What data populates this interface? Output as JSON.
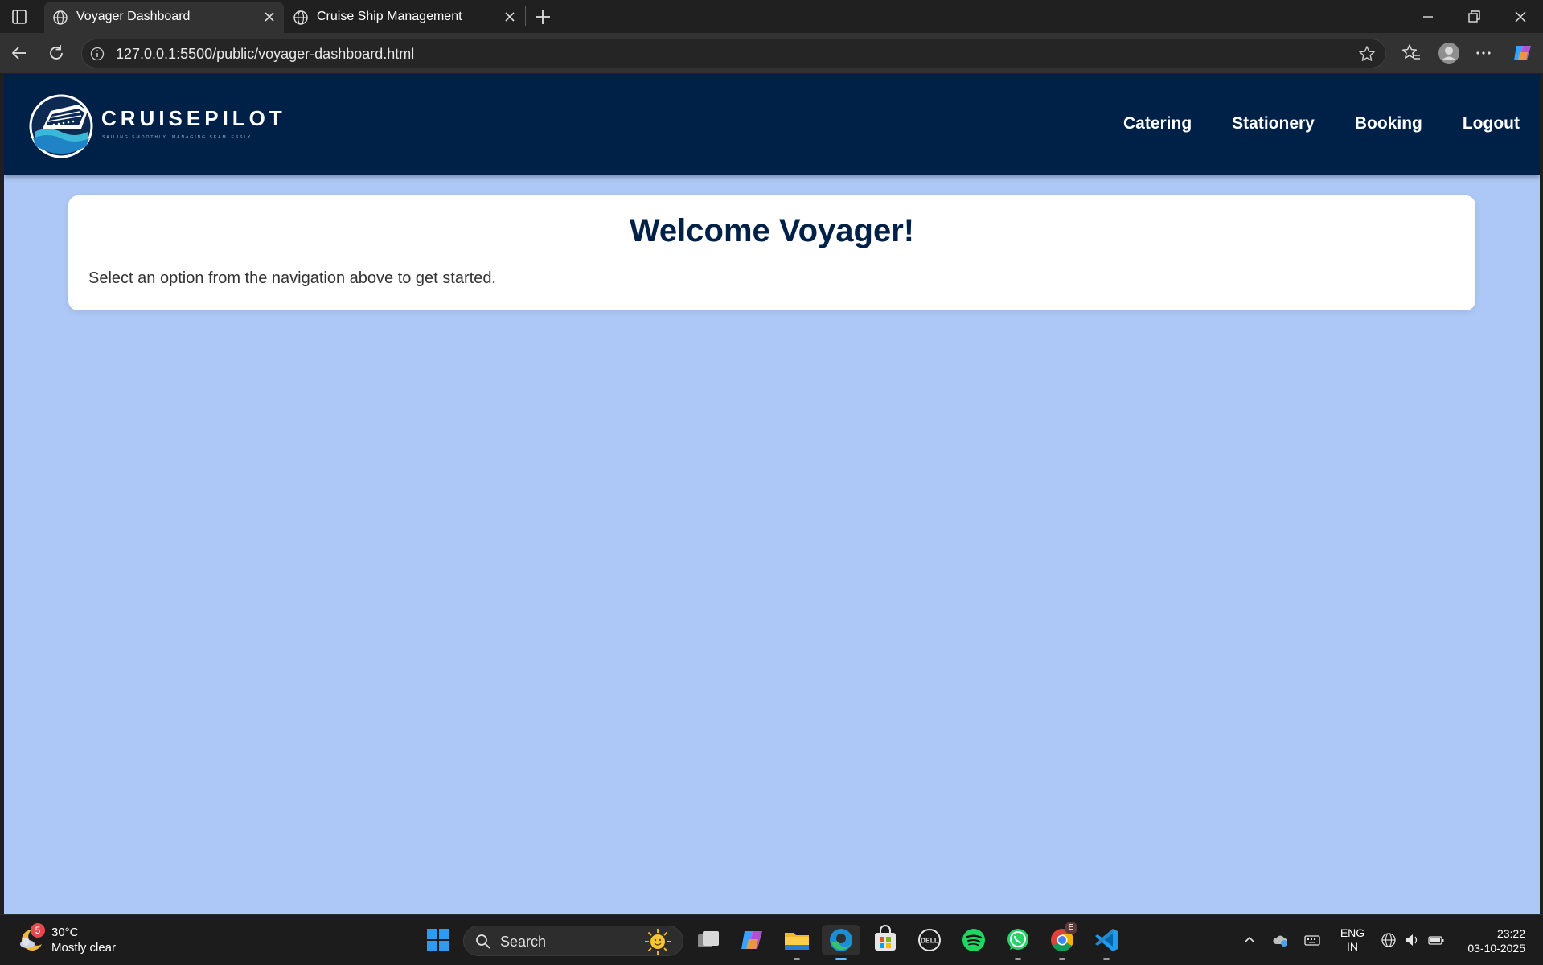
{
  "browser": {
    "tabs": [
      {
        "title": "Voyager Dashboard",
        "active": true
      },
      {
        "title": "Cruise Ship Management",
        "active": false
      }
    ],
    "address_url": "127.0.0.1:5500/public/voyager-dashboard.html"
  },
  "site": {
    "brand": "CRUISEPILOT",
    "tagline": "SAILING SMOOTHLY. MANAGING SEAMLESSLY",
    "nav": [
      "Catering",
      "Stationery",
      "Booking",
      "Logout"
    ],
    "colors": {
      "header_bg": "#002147",
      "page_bg": "#adc8f6",
      "card_bg": "#ffffff",
      "title_color": "#002147"
    }
  },
  "welcome": {
    "title": "Welcome Voyager!",
    "message": "Select an option from the navigation above to get started."
  },
  "taskbar": {
    "weather_temp": "30°C",
    "weather_desc": "Mostly clear",
    "weather_badge": "5",
    "search_label": "Search",
    "language_line1": "ENG",
    "language_line2": "IN",
    "time": "23:22",
    "date": "03-10-2025",
    "chrome_badge": "E",
    "apps": [
      "windows-start",
      "task-view",
      "copilot",
      "file-explorer",
      "edge",
      "microsoft-store",
      "dell",
      "spotify",
      "whatsapp",
      "chrome",
      "vscode"
    ]
  }
}
